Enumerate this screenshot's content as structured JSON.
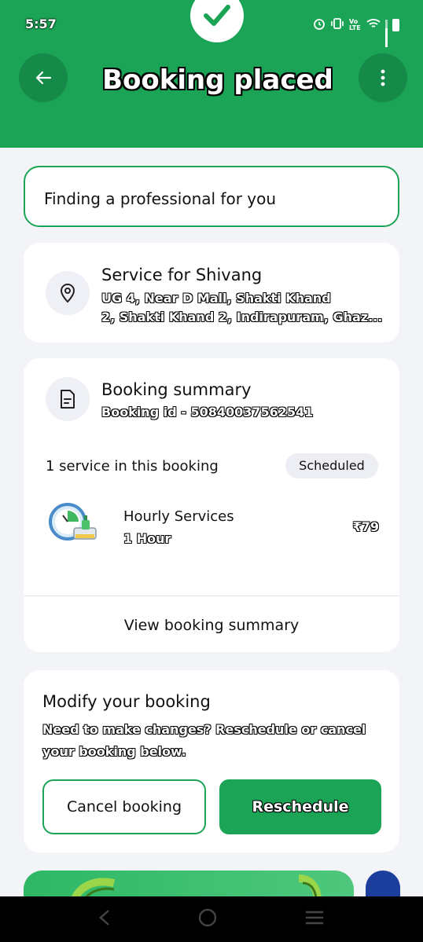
{
  "status_bar": {
    "time": "5:57",
    "icons": [
      "alarm-icon",
      "vibrate-icon",
      "volte-icon",
      "wifi-icon",
      "signal-icon",
      "battery-icon"
    ],
    "volte_label": "Vo LTE"
  },
  "header": {
    "title": "Booking placed",
    "background_color": "#1ba456",
    "back_icon": "arrow-left-icon",
    "menu_icon": "more-vertical-icon",
    "badge_icon": "check-icon"
  },
  "finding_card": {
    "text": "Finding a professional for you"
  },
  "address_card": {
    "icon": "location-pin-icon",
    "title": "Service for Shivang",
    "address_line1": "UG 4, Near D Mall, Shakti Khand",
    "address_line2": "2, Shakti Khand 2, Indirapuram, Ghaz..."
  },
  "summary_card": {
    "icon": "document-icon",
    "title": "Booking summary",
    "booking_id": "Booking id - 50840037562541",
    "service_count": "1 service in this booking",
    "status": "Scheduled",
    "service": {
      "name": "Hourly Services",
      "duration": "1 Hour",
      "price": "₹79",
      "thumb_icon": "clock-cleaning-icon"
    },
    "view_summary_label": "View booking summary"
  },
  "modify_card": {
    "title": "Modify your booking",
    "description": "Need to make changes? Reschedule or cancel your booking below.",
    "cancel_label": "Cancel booking",
    "reschedule_label": "Reschedule"
  },
  "nav_bar": {
    "icons": [
      "nav-back-icon",
      "nav-home-icon",
      "nav-recents-icon"
    ]
  },
  "colors": {
    "accent": "#1ba456",
    "background": "#f3f4f8"
  }
}
